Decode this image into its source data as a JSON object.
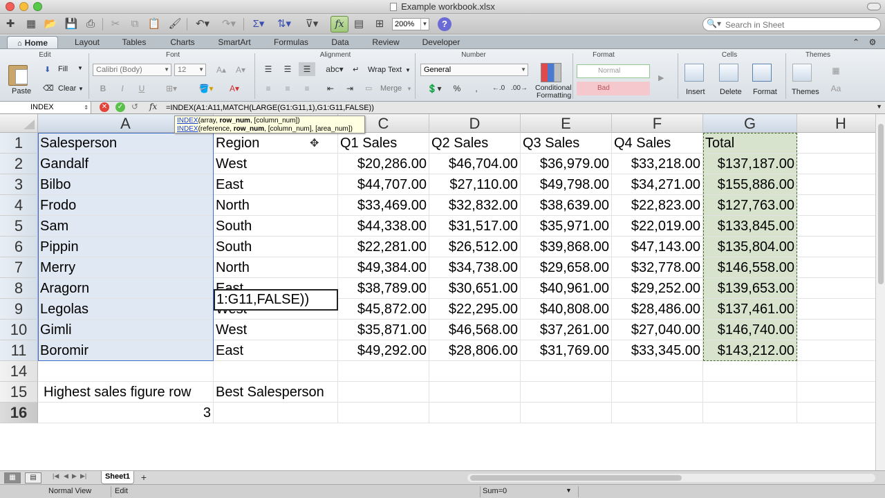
{
  "window": {
    "title": "Example workbook.xlsx"
  },
  "toolbar": {
    "zoom": "200%",
    "search_placeholder": "Search in Sheet",
    "icons": [
      "new-icon",
      "templates-icon",
      "open-icon",
      "save-icon",
      "print-icon",
      "cut-icon",
      "copy-icon",
      "paste-icon",
      "format-painter-icon",
      "undo-icon",
      "redo-icon",
      "autosum-icon",
      "sort-icon",
      "filter-icon",
      "function-icon",
      "gallery-icon",
      "toolbox-icon",
      "help-icon"
    ]
  },
  "ribbon_tabs": [
    "Home",
    "Layout",
    "Tables",
    "Charts",
    "SmartArt",
    "Formulas",
    "Data",
    "Review",
    "Developer"
  ],
  "ribbon": {
    "groups": [
      "Edit",
      "Font",
      "Alignment",
      "Number",
      "Format",
      "Cells",
      "Themes"
    ],
    "paste": "Paste",
    "fill": "Fill",
    "clear": "Clear",
    "font_name": "Calibri (Body)",
    "font_size": "12",
    "wrap_text": "Wrap Text",
    "merge": "Merge",
    "number_format": "General",
    "conditional_formatting_1": "Conditional",
    "conditional_formatting_2": "Formatting",
    "style_normal": "Normal",
    "style_bad": "Bad",
    "insert": "Insert",
    "delete": "Delete",
    "format": "Format",
    "themes": "Themes",
    "bold": "B",
    "italic": "I",
    "underline": "U",
    "abc": "abc"
  },
  "formula_bar": {
    "name_box": "INDEX",
    "formula": "=INDEX(A1:A11,MATCH(LARGE(G1:G11,1),G1:G11,FALSE))"
  },
  "tooltip": {
    "fn1": "INDEX",
    "args1_pre": "(array, ",
    "args1_bold": "row_num",
    "args1_post": ", [column_num])",
    "fn2": "INDEX",
    "args2_pre": "(reference, ",
    "args2_bold": "row_num",
    "args2_post": ", [column_num], [area_num])"
  },
  "sheet": {
    "columns": [
      "A",
      "B",
      "C",
      "D",
      "E",
      "F",
      "G",
      "H"
    ],
    "header_row": [
      "Salesperson",
      "Region",
      "Q1 Sales",
      "Q2 Sales",
      "Q3 Sales",
      "Q4 Sales",
      "Total"
    ],
    "rows": [
      {
        "num": "2",
        "cells": [
          "Gandalf",
          "West",
          "$20,286.00",
          "$46,704.00",
          "$36,979.00",
          "$33,218.00",
          "$137,187.00"
        ]
      },
      {
        "num": "3",
        "cells": [
          "Bilbo",
          "East",
          "$44,707.00",
          "$27,110.00",
          "$49,798.00",
          "$34,271.00",
          "$155,886.00"
        ]
      },
      {
        "num": "4",
        "cells": [
          "Frodo",
          "North",
          "$33,469.00",
          "$32,832.00",
          "$38,639.00",
          "$22,823.00",
          "$127,763.00"
        ]
      },
      {
        "num": "5",
        "cells": [
          "Sam",
          "South",
          "$44,338.00",
          "$31,517.00",
          "$35,971.00",
          "$22,019.00",
          "$133,845.00"
        ]
      },
      {
        "num": "6",
        "cells": [
          "Pippin",
          "South",
          "$22,281.00",
          "$26,512.00",
          "$39,868.00",
          "$47,143.00",
          "$135,804.00"
        ]
      },
      {
        "num": "7",
        "cells": [
          "Merry",
          "North",
          "$49,384.00",
          "$34,738.00",
          "$29,658.00",
          "$32,778.00",
          "$146,558.00"
        ]
      },
      {
        "num": "8",
        "cells": [
          "Aragorn",
          "East",
          "$38,789.00",
          "$30,651.00",
          "$40,961.00",
          "$29,252.00",
          "$139,653.00"
        ]
      },
      {
        "num": "9",
        "cells": [
          "Legolas",
          "West",
          "$45,872.00",
          "$22,295.00",
          "$40,808.00",
          "$28,486.00",
          "$137,461.00"
        ]
      },
      {
        "num": "10",
        "cells": [
          "Gimli",
          "West",
          "$35,871.00",
          "$46,568.00",
          "$37,261.00",
          "$27,040.00",
          "$146,740.00"
        ]
      },
      {
        "num": "11",
        "cells": [
          "Boromir",
          "East",
          "$49,292.00",
          "$28,806.00",
          "$31,769.00",
          "$33,345.00",
          "$143,212.00"
        ]
      }
    ],
    "row_numbers": [
      "1",
      "14",
      "15",
      "16"
    ],
    "label_highest": "Highest sales figure row",
    "label_best": "Best Salesperson",
    "value_highest": "3",
    "editing_text": "1:G11,FALSE))"
  },
  "sheet_tabs": {
    "active": "Sheet1",
    "add": "+"
  },
  "status_bar": {
    "view": "Normal View",
    "mode": "Edit",
    "sum": "Sum=0"
  },
  "colors": {
    "selection_a": "#dfe8f3",
    "selection_g": "#d7e3cc",
    "accent_green": "#9fc77a"
  }
}
